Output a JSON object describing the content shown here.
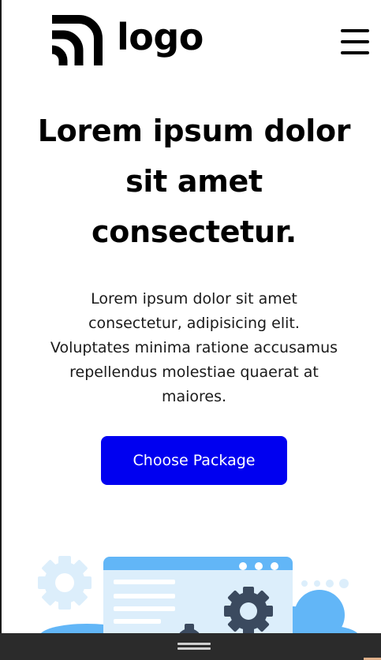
{
  "header": {
    "logo_text": "logo",
    "logo_icon": "logo-arcs-icon",
    "menu_icon": "hamburger-menu-icon"
  },
  "hero": {
    "title": "Lorem ipsum dolor sit amet consectetur.",
    "description": "Lorem ipsum dolor sit amet consectetur, adipisicing elit. Voluptates minima ratione accusamus repellendus molestiae quaerat at maiores.",
    "cta_label": "Choose Package"
  },
  "illustration": {
    "icons": [
      "gear-icon",
      "browser-window-icon",
      "cloud-icon"
    ]
  },
  "colors": {
    "primary": "#0000f0",
    "text": "#000000",
    "illustration_blue": "#62b6f7",
    "illustration_light": "#dceefb",
    "gear_dark": "#3b4a5f",
    "bottom_bar": "#2b2b2b"
  }
}
